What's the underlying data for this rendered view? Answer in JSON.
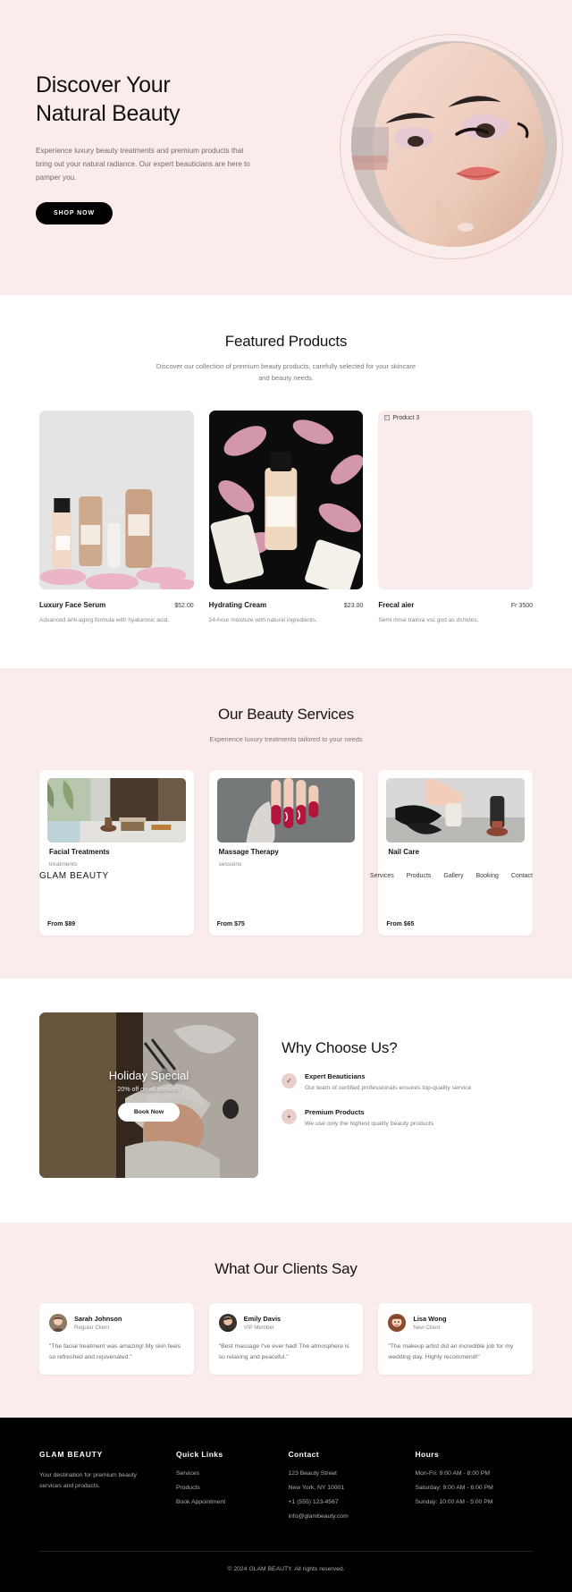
{
  "hero": {
    "title_line1": "Discover Your",
    "title_line2": "Natural Beauty",
    "subtitle": "Experience luxury beauty treatments and premium products that bring out your natural radiance. Our expert beauticians are here to pamper you.",
    "cta_label": "SHOP NOW",
    "image_alt": "woman-applying-makeup-portrait",
    "background_color": "#faeceb"
  },
  "products_section": {
    "title": "Featured Products",
    "subtitle": "Discover our collection of premium beauty products, carefully selected for your skincare and beauty needs.",
    "items": [
      {
        "name": "Luxury Face Serum",
        "price": "$52.00",
        "description": "Advanced anti-aging formula with hyaluronic acid.",
        "image_alt": "skincare-bottles-on-petals",
        "broken": false
      },
      {
        "name": "Hydrating Cream",
        "price": "$23.00",
        "description": "24-hour moisture with natural ingredients.",
        "image_alt": "serum-bottle-on-pink-petals-dark",
        "broken": false
      },
      {
        "name": "Frecal aier",
        "price": "Fr 3500",
        "description": "Semi mrse tralnra vsc gnd as dsmdes.",
        "image_alt": "Product 3",
        "broken": true
      }
    ]
  },
  "services_section": {
    "title": "Our Beauty Services",
    "subtitle": "Experience luxury treatments tailored to your needs",
    "items": [
      {
        "title": "Facial Treatments",
        "description_tail": "treatments",
        "price": "From $89",
        "image_alt": "spa-garden-lounge"
      },
      {
        "title": "Massage Therapy",
        "description_tail": "sessions",
        "price": "From $75",
        "image_alt": "red-manicured-nails"
      },
      {
        "title": "Nail Care",
        "description_tail": "",
        "price": "From $65",
        "image_alt": "nail-technician-gloves"
      }
    ]
  },
  "float_nav": {
    "brand": "GLAM BEAUTY",
    "links": [
      "Services",
      "Products",
      "Gallery",
      "Booking",
      "Contact"
    ]
  },
  "promo": {
    "title": "Holiday Special",
    "subtitle": "20% off on all services",
    "button_label": "Book Now",
    "image_alt": "spa-facial-treatment"
  },
  "why_section": {
    "title": "Why Choose Us?",
    "features": [
      {
        "icon": "check-icon",
        "glyph": "✓",
        "name": "Expert Beauticians",
        "description": "Our team of certified professionals ensures top-quality service"
      },
      {
        "icon": "plus-icon",
        "glyph": "+",
        "name": "Premium Products",
        "description": "We use only the highest quality beauty products"
      }
    ]
  },
  "testimonials_section": {
    "title": "What Our Clients Say",
    "items": [
      {
        "name": "Sarah Johnson",
        "role": "Regular Client",
        "quote": "\"The facial treatment was amazing! My skin feels so refreshed and rejuvenated.\"",
        "avatar_alt": "sarah-johnson-avatar"
      },
      {
        "name": "Emily Davis",
        "role": "VIP Member",
        "quote": "\"Best massage I've ever had! The atmosphere is so relaxing and peaceful.\"",
        "avatar_alt": "emily-davis-avatar"
      },
      {
        "name": "Lisa Wong",
        "role": "New Client",
        "quote": "\"The makeup artist did an incredible job for my wedding day. Highly recommend!\"",
        "avatar_alt": "lisa-wong-avatar"
      }
    ]
  },
  "footer": {
    "brand": "GLAM BEAUTY",
    "brand_text": "Your destination for premium beauty services and products.",
    "quick_links_heading": "Quick Links",
    "quick_links": [
      "Services",
      "Products",
      "Book Appointment"
    ],
    "contact_heading": "Contact",
    "contact_lines": [
      "123 Beauty Street",
      "New York, NY 10001",
      "+1 (555) 123-4567",
      "info@glambeauty.com"
    ],
    "hours_heading": "Hours",
    "hours_lines": [
      "Mon-Fri: 9:00 AM - 8:00 PM",
      "Saturday: 9:00 AM - 6:00 PM",
      "Sunday: 10:00 AM - 5:00 PM"
    ],
    "copyright": "© 2024 GLAM BEAUTY. All rights reserved."
  }
}
